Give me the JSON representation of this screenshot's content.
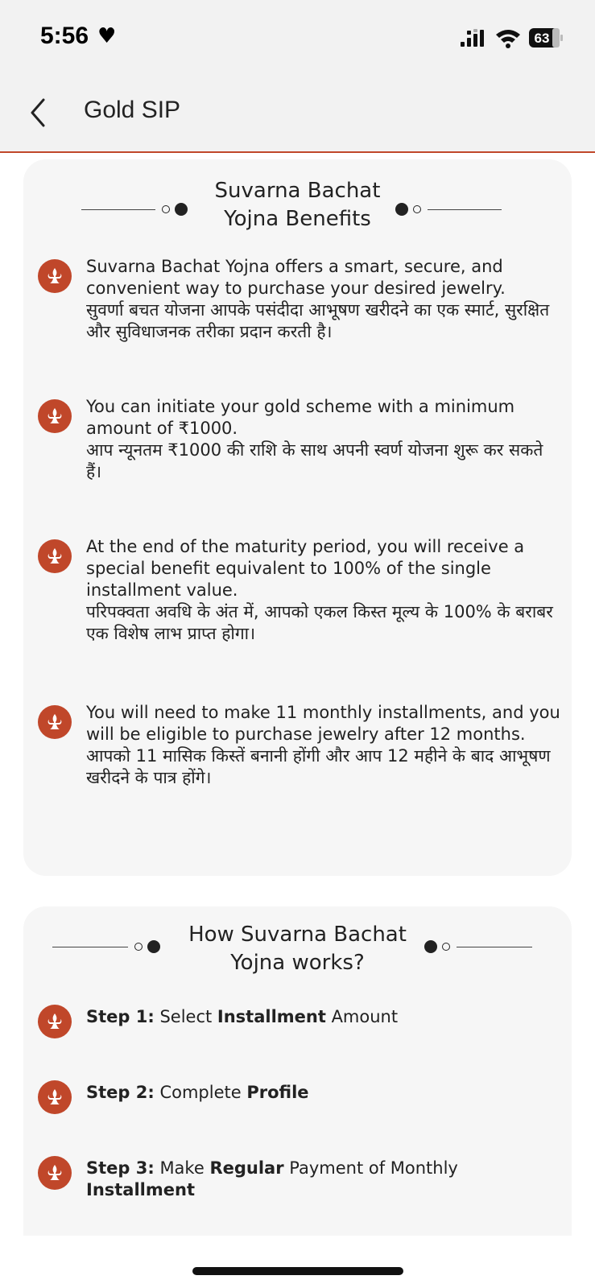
{
  "status": {
    "time": "5:56",
    "battery": "63"
  },
  "nav": {
    "title": "Gold SIP"
  },
  "benefits": {
    "title_line1": "Suvarna Bachat",
    "title_line2": "Yojna Benefits",
    "items": [
      {
        "en": "Suvarna Bachat Yojna offers a smart, secure, and convenient way to purchase your desired jewelry.",
        "hi": "सुवर्णा बचत योजना आपके पसंदीदा आभूषण खरीदने का एक स्मार्ट, सुरक्षित और सुविधाजनक तरीका प्रदान करती है।"
      },
      {
        "en": "You can initiate your gold scheme with a minimum amount of ₹1000.",
        "hi": "आप न्यूनतम ₹1000 की राशि के साथ अपनी स्वर्ण योजना शुरू कर सकते हैं।"
      },
      {
        "en": "At the end of the maturity period, you will receive a special benefit equivalent to 100% of the single installment value.",
        "hi": "परिपक्वता अवधि के अंत में, आपको एकल किस्त मूल्य के 100% के बराबर एक विशेष लाभ प्राप्त होगा।"
      },
      {
        "en": "You will need to make 11 monthly installments, and you will be eligible to purchase jewelry after 12 months.",
        "hi": "आपको 11 मासिक किस्तें बनानी होंगी और आप 12 महीने के बाद आभूषण खरीदने के पात्र होंगे।"
      }
    ]
  },
  "how_it_works": {
    "title_line1": "How Suvarna Bachat",
    "title_line2": "Yojna works?",
    "steps": [
      {
        "label": "Step 1:",
        "parts": [
          " Select ",
          "Installment",
          " Amount"
        ]
      },
      {
        "label": "Step 2:",
        "parts": [
          " Complete ",
          "Profile",
          ""
        ]
      },
      {
        "label": "Step 3:",
        "parts": [
          " Make ",
          "Regular",
          " Payment of Monthly ",
          "Installment"
        ]
      }
    ]
  },
  "colors": {
    "accent": "#c0472a",
    "card_bg": "#f6f6f6",
    "page_bg": "#f2f2f2"
  },
  "icons": {
    "back": "chevron-left-icon",
    "bullet": "fleur-de-lis-icon"
  }
}
